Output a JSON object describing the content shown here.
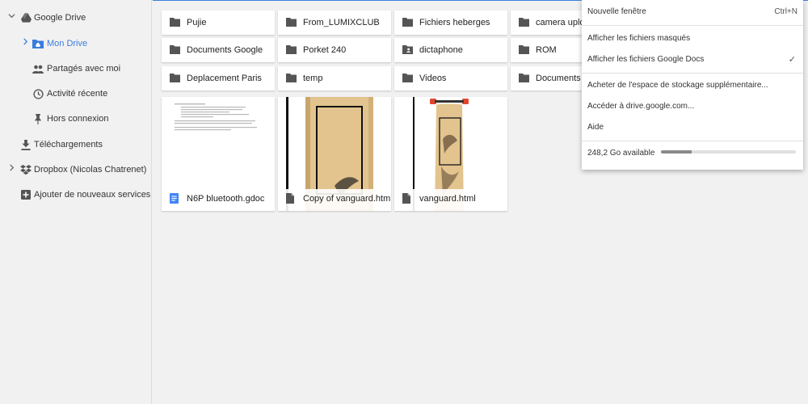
{
  "sidebar": {
    "items": [
      {
        "label": "Google Drive",
        "icon": "google-drive-icon",
        "chevron": "down"
      },
      {
        "label": "Mon Drive",
        "icon": "my-drive-folder-icon",
        "chevron": "right",
        "active": true
      },
      {
        "label": "Partagés avec moi",
        "icon": "people-icon"
      },
      {
        "label": "Activité récente",
        "icon": "clock-icon"
      },
      {
        "label": "Hors connexion",
        "icon": "pin-icon"
      },
      {
        "label": "Téléchargements",
        "icon": "download-icon"
      },
      {
        "label": "Dropbox (Nicolas Chatrenet)",
        "icon": "dropbox-icon",
        "chevron": "right"
      },
      {
        "label": "Ajouter de nouveaux services",
        "icon": "add-box-icon"
      }
    ]
  },
  "folders": [
    {
      "name": "Pujie",
      "icon": "folder-icon"
    },
    {
      "name": "From_LUMIXCLUB",
      "icon": "folder-icon"
    },
    {
      "name": "Fichiers heberges",
      "icon": "folder-icon"
    },
    {
      "name": "camera uploads",
      "icon": "folder-icon"
    },
    {
      "name": "Documents Google",
      "icon": "folder-icon"
    },
    {
      "name": "Porket 240",
      "icon": "folder-icon"
    },
    {
      "name": "dictaphone",
      "icon": "shared-folder-icon"
    },
    {
      "name": "ROM",
      "icon": "folder-icon"
    },
    {
      "name": "Deplacement Paris",
      "icon": "folder-icon"
    },
    {
      "name": "temp",
      "icon": "folder-icon"
    },
    {
      "name": "Videos",
      "icon": "folder-icon"
    },
    {
      "name": "Documents divers",
      "icon": "folder-icon"
    }
  ],
  "files": [
    {
      "name": "N6P bluetooth.gdoc",
      "icon": "google-docs-icon",
      "thumb": "document"
    },
    {
      "name": "Copy of vanguard.html",
      "icon": "file-icon",
      "thumb": "longboard-closeup"
    },
    {
      "name": "vanguard.html",
      "icon": "file-icon",
      "thumb": "longboard-full"
    }
  ],
  "menu": {
    "new_window": {
      "label": "Nouvelle fenêtre",
      "shortcut": "Ctrl+N"
    },
    "show_hidden": {
      "label": "Afficher les fichiers masqués"
    },
    "show_gdocs": {
      "label": "Afficher les fichiers Google Docs",
      "checked": true,
      "check": "✓"
    },
    "buy_storage": {
      "label": "Acheter de l'espace de stockage supplémentaire..."
    },
    "go_drive": {
      "label": "Accéder à drive.google.com..."
    },
    "help": {
      "label": "Aide"
    },
    "storage": {
      "label": "248,2 Go available",
      "used_fraction": 0.23
    }
  },
  "colors": {
    "accent": "#3b7ddd",
    "icon_gray": "#555555",
    "docs_blue": "#4285f4",
    "wood": "#e2c08a"
  }
}
